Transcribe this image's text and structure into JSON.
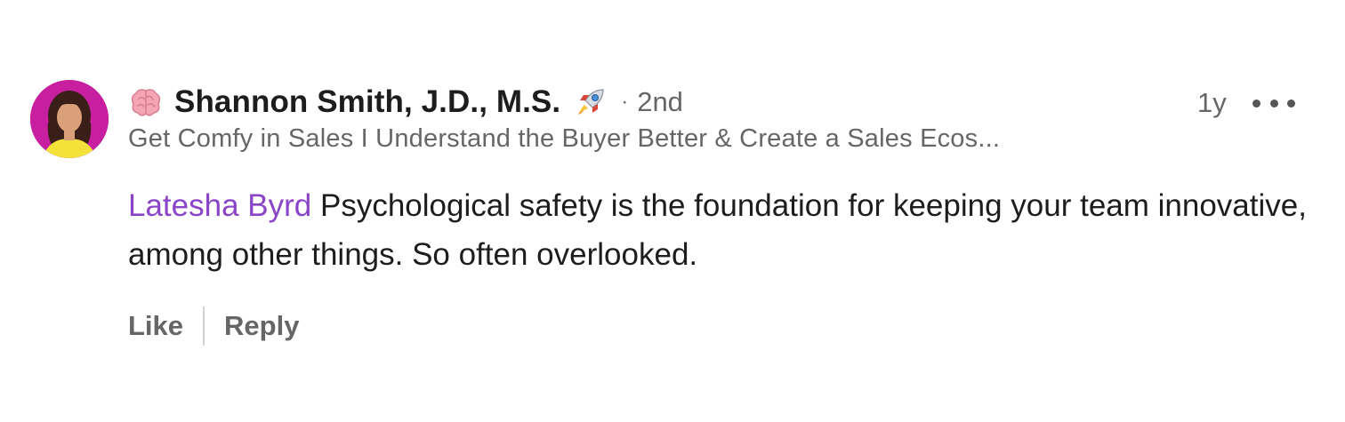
{
  "comment": {
    "author": {
      "name": "Shannon Smith, J.D., M.S.",
      "prefix_icon": "brain-icon",
      "suffix_icon": "rocket-icon",
      "connection_separator": "·",
      "connection_degree": "2nd",
      "headline": "Get Comfy in Sales I Understand the Buyer Better & Create a Sales Ecos..."
    },
    "timestamp": "1y",
    "more_icon": "more-horizontal-icon",
    "mention": "Latesha Byrd",
    "text": " Psychological safety is the foundation for keeping your team innovative, among other things. So often overlooked.",
    "actions": {
      "like_label": "Like",
      "reply_label": "Reply"
    }
  },
  "colors": {
    "mention": "#8a44c8",
    "primary_text": "#1d1d1d",
    "secondary_text": "#666666",
    "avatar_bg": "#c81fa0"
  }
}
